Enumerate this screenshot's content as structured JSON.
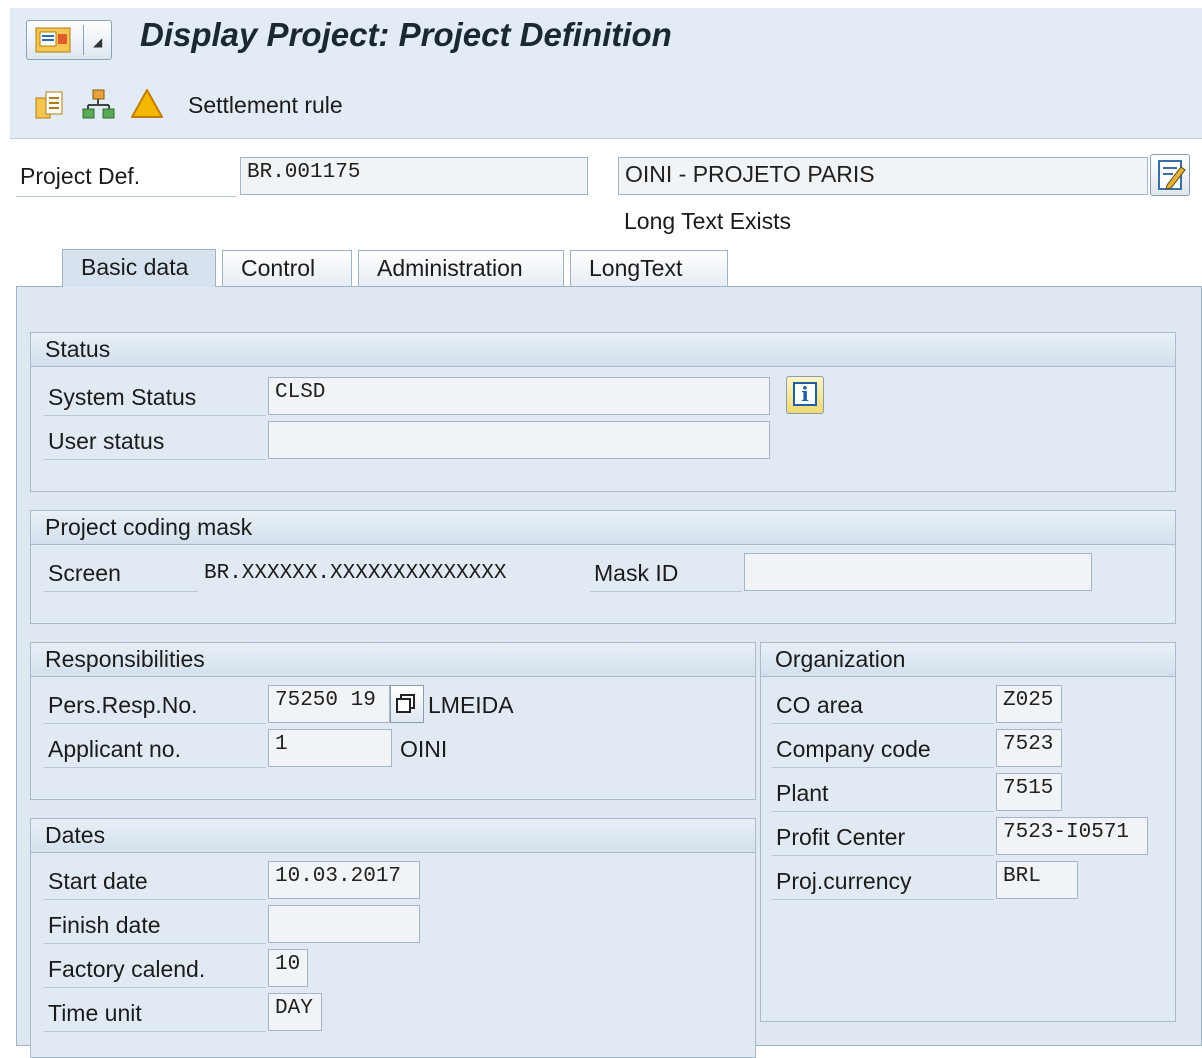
{
  "window": {
    "title": "Display Project: Project Definition"
  },
  "toolbar": {
    "icons": [
      "hierarchy-detail-icon",
      "structure-tree-icon",
      "warning-icon"
    ],
    "settlement_rule_label": "Settlement rule"
  },
  "header": {
    "project_def_label": "Project Def.",
    "project_def_value": "BR.001175",
    "description_value": "OINI - PROJETO PARIS",
    "long_text_note": "Long Text Exists"
  },
  "tabs": [
    {
      "label": "Basic data",
      "active": true
    },
    {
      "label": "Control",
      "active": false
    },
    {
      "label": "Administration",
      "active": false
    },
    {
      "label": "LongText",
      "active": false
    }
  ],
  "status": {
    "title": "Status",
    "system_status_label": "System Status",
    "system_status_value": "CLSD",
    "user_status_label": "User status",
    "user_status_value": ""
  },
  "coding_mask": {
    "title": "Project coding mask",
    "screen_label": "Screen",
    "screen_value": "BR.XXXXXX.XXXXXXXXXXXXXX",
    "mask_id_label": "Mask ID",
    "mask_id_value": ""
  },
  "responsibilities": {
    "title": "Responsibilities",
    "pers_resp_label": "Pers.Resp.No.",
    "pers_resp_value": "75250 19",
    "pers_resp_name": "LMEIDA",
    "applicant_label": "Applicant no.",
    "applicant_value": "1",
    "applicant_name": "OINI"
  },
  "organization": {
    "title": "Organization",
    "co_area_label": "CO area",
    "co_area_value": "Z025",
    "company_code_label": "Company code",
    "company_code_value": "7523",
    "plant_label": "Plant",
    "plant_value": "7515",
    "profit_center_label": "Profit Center",
    "profit_center_value": "7523-I0571",
    "currency_label": "Proj.currency",
    "currency_value": "BRL"
  },
  "dates": {
    "title": "Dates",
    "start_label": "Start date",
    "start_value": "10.03.2017",
    "finish_label": "Finish date",
    "finish_value": "",
    "factory_calend_label": "Factory calend.",
    "factory_calend_value": "10",
    "time_unit_label": "Time unit",
    "time_unit_value": "DAY"
  }
}
